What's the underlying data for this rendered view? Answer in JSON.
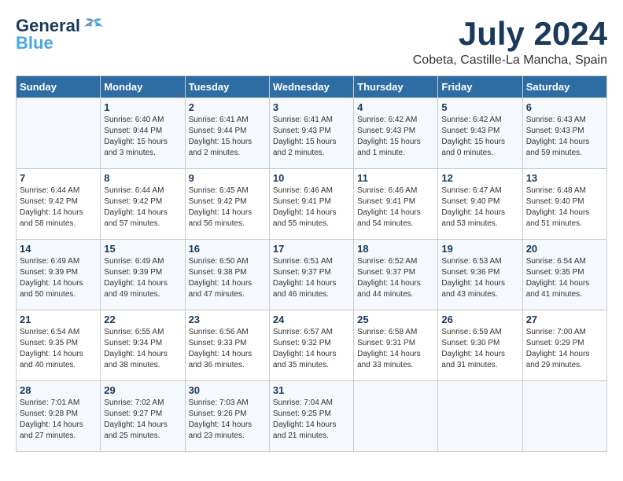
{
  "logo": {
    "general": "General",
    "blue": "Blue"
  },
  "title": "July 2024",
  "location": "Cobeta, Castille-La Mancha, Spain",
  "days_of_week": [
    "Sunday",
    "Monday",
    "Tuesday",
    "Wednesday",
    "Thursday",
    "Friday",
    "Saturday"
  ],
  "weeks": [
    [
      {
        "day": "",
        "info": ""
      },
      {
        "day": "1",
        "info": "Sunrise: 6:40 AM\nSunset: 9:44 PM\nDaylight: 15 hours\nand 3 minutes."
      },
      {
        "day": "2",
        "info": "Sunrise: 6:41 AM\nSunset: 9:44 PM\nDaylight: 15 hours\nand 2 minutes."
      },
      {
        "day": "3",
        "info": "Sunrise: 6:41 AM\nSunset: 9:43 PM\nDaylight: 15 hours\nand 2 minutes."
      },
      {
        "day": "4",
        "info": "Sunrise: 6:42 AM\nSunset: 9:43 PM\nDaylight: 15 hours\nand 1 minute."
      },
      {
        "day": "5",
        "info": "Sunrise: 6:42 AM\nSunset: 9:43 PM\nDaylight: 15 hours\nand 0 minutes."
      },
      {
        "day": "6",
        "info": "Sunrise: 6:43 AM\nSunset: 9:43 PM\nDaylight: 14 hours\nand 59 minutes."
      }
    ],
    [
      {
        "day": "7",
        "info": "Sunrise: 6:44 AM\nSunset: 9:42 PM\nDaylight: 14 hours\nand 58 minutes."
      },
      {
        "day": "8",
        "info": "Sunrise: 6:44 AM\nSunset: 9:42 PM\nDaylight: 14 hours\nand 57 minutes."
      },
      {
        "day": "9",
        "info": "Sunrise: 6:45 AM\nSunset: 9:42 PM\nDaylight: 14 hours\nand 56 minutes."
      },
      {
        "day": "10",
        "info": "Sunrise: 6:46 AM\nSunset: 9:41 PM\nDaylight: 14 hours\nand 55 minutes."
      },
      {
        "day": "11",
        "info": "Sunrise: 6:46 AM\nSunset: 9:41 PM\nDaylight: 14 hours\nand 54 minutes."
      },
      {
        "day": "12",
        "info": "Sunrise: 6:47 AM\nSunset: 9:40 PM\nDaylight: 14 hours\nand 53 minutes."
      },
      {
        "day": "13",
        "info": "Sunrise: 6:48 AM\nSunset: 9:40 PM\nDaylight: 14 hours\nand 51 minutes."
      }
    ],
    [
      {
        "day": "14",
        "info": "Sunrise: 6:49 AM\nSunset: 9:39 PM\nDaylight: 14 hours\nand 50 minutes."
      },
      {
        "day": "15",
        "info": "Sunrise: 6:49 AM\nSunset: 9:39 PM\nDaylight: 14 hours\nand 49 minutes."
      },
      {
        "day": "16",
        "info": "Sunrise: 6:50 AM\nSunset: 9:38 PM\nDaylight: 14 hours\nand 47 minutes."
      },
      {
        "day": "17",
        "info": "Sunrise: 6:51 AM\nSunset: 9:37 PM\nDaylight: 14 hours\nand 46 minutes."
      },
      {
        "day": "18",
        "info": "Sunrise: 6:52 AM\nSunset: 9:37 PM\nDaylight: 14 hours\nand 44 minutes."
      },
      {
        "day": "19",
        "info": "Sunrise: 6:53 AM\nSunset: 9:36 PM\nDaylight: 14 hours\nand 43 minutes."
      },
      {
        "day": "20",
        "info": "Sunrise: 6:54 AM\nSunset: 9:35 PM\nDaylight: 14 hours\nand 41 minutes."
      }
    ],
    [
      {
        "day": "21",
        "info": "Sunrise: 6:54 AM\nSunset: 9:35 PM\nDaylight: 14 hours\nand 40 minutes."
      },
      {
        "day": "22",
        "info": "Sunrise: 6:55 AM\nSunset: 9:34 PM\nDaylight: 14 hours\nand 38 minutes."
      },
      {
        "day": "23",
        "info": "Sunrise: 6:56 AM\nSunset: 9:33 PM\nDaylight: 14 hours\nand 36 minutes."
      },
      {
        "day": "24",
        "info": "Sunrise: 6:57 AM\nSunset: 9:32 PM\nDaylight: 14 hours\nand 35 minutes."
      },
      {
        "day": "25",
        "info": "Sunrise: 6:58 AM\nSunset: 9:31 PM\nDaylight: 14 hours\nand 33 minutes."
      },
      {
        "day": "26",
        "info": "Sunrise: 6:59 AM\nSunset: 9:30 PM\nDaylight: 14 hours\nand 31 minutes."
      },
      {
        "day": "27",
        "info": "Sunrise: 7:00 AM\nSunset: 9:29 PM\nDaylight: 14 hours\nand 29 minutes."
      }
    ],
    [
      {
        "day": "28",
        "info": "Sunrise: 7:01 AM\nSunset: 9:28 PM\nDaylight: 14 hours\nand 27 minutes."
      },
      {
        "day": "29",
        "info": "Sunrise: 7:02 AM\nSunset: 9:27 PM\nDaylight: 14 hours\nand 25 minutes."
      },
      {
        "day": "30",
        "info": "Sunrise: 7:03 AM\nSunset: 9:26 PM\nDaylight: 14 hours\nand 23 minutes."
      },
      {
        "day": "31",
        "info": "Sunrise: 7:04 AM\nSunset: 9:25 PM\nDaylight: 14 hours\nand 21 minutes."
      },
      {
        "day": "",
        "info": ""
      },
      {
        "day": "",
        "info": ""
      },
      {
        "day": "",
        "info": ""
      }
    ]
  ]
}
